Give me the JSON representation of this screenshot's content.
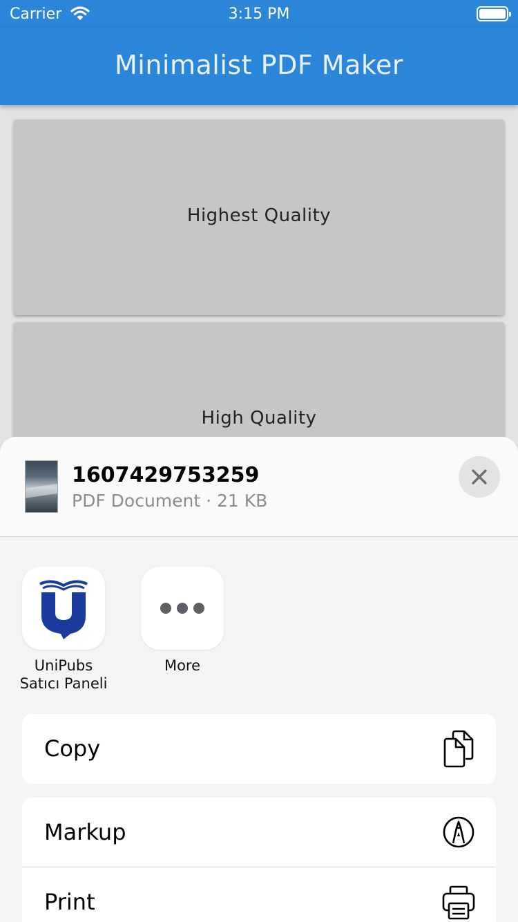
{
  "status_bar": {
    "carrier": "Carrier",
    "time": "3:15 PM"
  },
  "app_bar": {
    "title": "Minimalist PDF Maker",
    "color": "#2b85d9"
  },
  "quality_options": [
    {
      "label": "Highest Quality"
    },
    {
      "label": "High Quality"
    }
  ],
  "share_sheet": {
    "document": {
      "name": "1607429753259",
      "meta": "PDF Document · 21 KB"
    },
    "apps": [
      {
        "label": "UniPubs\nSatıcı Paneli",
        "icon": "unipubs-logo-icon"
      },
      {
        "label": "More",
        "icon": "ellipsis-icon"
      }
    ],
    "actions": [
      {
        "label": "Copy",
        "icon": "copy-icon"
      },
      {
        "label": "Markup",
        "icon": "markup-icon"
      },
      {
        "label": "Print",
        "icon": "printer-icon"
      }
    ]
  }
}
